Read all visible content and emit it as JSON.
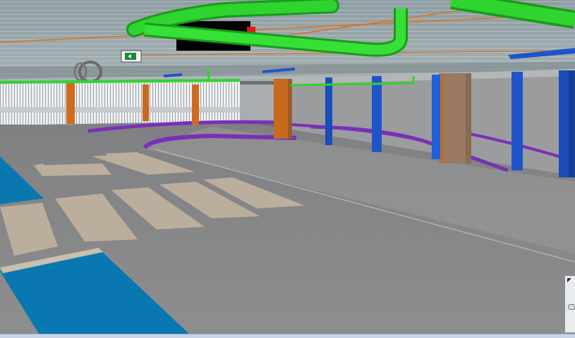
{
  "viewport": {
    "view_type": "3d-model-view",
    "subject": "parking-garage-interior"
  },
  "colors": {
    "ceiling": "#8a9aa0",
    "floor": "#8c8c8c",
    "wall": "#9a9a9a",
    "pipe_green": "#2fd42f",
    "pipe_orange": "#e0701e",
    "column_orange": "#c8691e",
    "column_blue": "#1f55c8",
    "curb_purple": "#7a2fb8",
    "parking_bay_blue": "#0a78b0",
    "marking_tan": "#bcae9c",
    "status_strip": "#c9d6e8"
  },
  "icons": {
    "exit_sign": "exit-sign-icon",
    "viewcube": "viewcube-icon"
  }
}
